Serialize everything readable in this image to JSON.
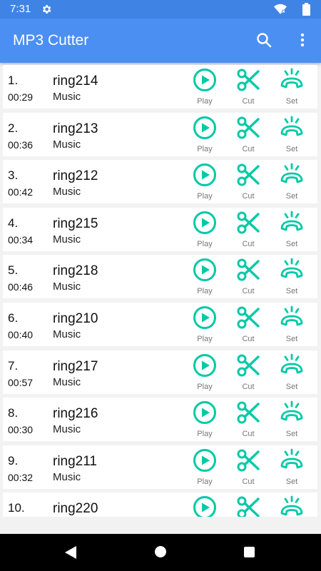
{
  "status_bar": {
    "time": "7:31",
    "icons": [
      "gear-icon",
      "wifi-icon",
      "battery-icon"
    ]
  },
  "app_bar": {
    "title": "MP3 Cutter",
    "icons": [
      "search-icon",
      "more-vert-icon"
    ]
  },
  "theme": {
    "accent": "#00c9a7",
    "app_bar": "#4b8ff2",
    "status_bar": "#3f84e5"
  },
  "action_labels": {
    "play": "Play",
    "cut": "Cut",
    "set": "Set"
  },
  "songs": [
    {
      "num": "1.",
      "duration": "00:29",
      "name": "ring214",
      "category": "Music"
    },
    {
      "num": "2.",
      "duration": "00:36",
      "name": "ring213",
      "category": "Music"
    },
    {
      "num": "3.",
      "duration": "00:42",
      "name": "ring212",
      "category": "Music"
    },
    {
      "num": "4.",
      "duration": "00:34",
      "name": "ring215",
      "category": "Music"
    },
    {
      "num": "5.",
      "duration": "00:46",
      "name": "ring218",
      "category": "Music"
    },
    {
      "num": "6.",
      "duration": "00:40",
      "name": "ring210",
      "category": "Music"
    },
    {
      "num": "7.",
      "duration": "00:57",
      "name": "ring217",
      "category": "Music"
    },
    {
      "num": "8.",
      "duration": "00:30",
      "name": "ring216",
      "category": "Music"
    },
    {
      "num": "9.",
      "duration": "00:32",
      "name": "ring211",
      "category": "Music"
    },
    {
      "num": "10.",
      "duration": "",
      "name": "ring220",
      "category": ""
    }
  ]
}
